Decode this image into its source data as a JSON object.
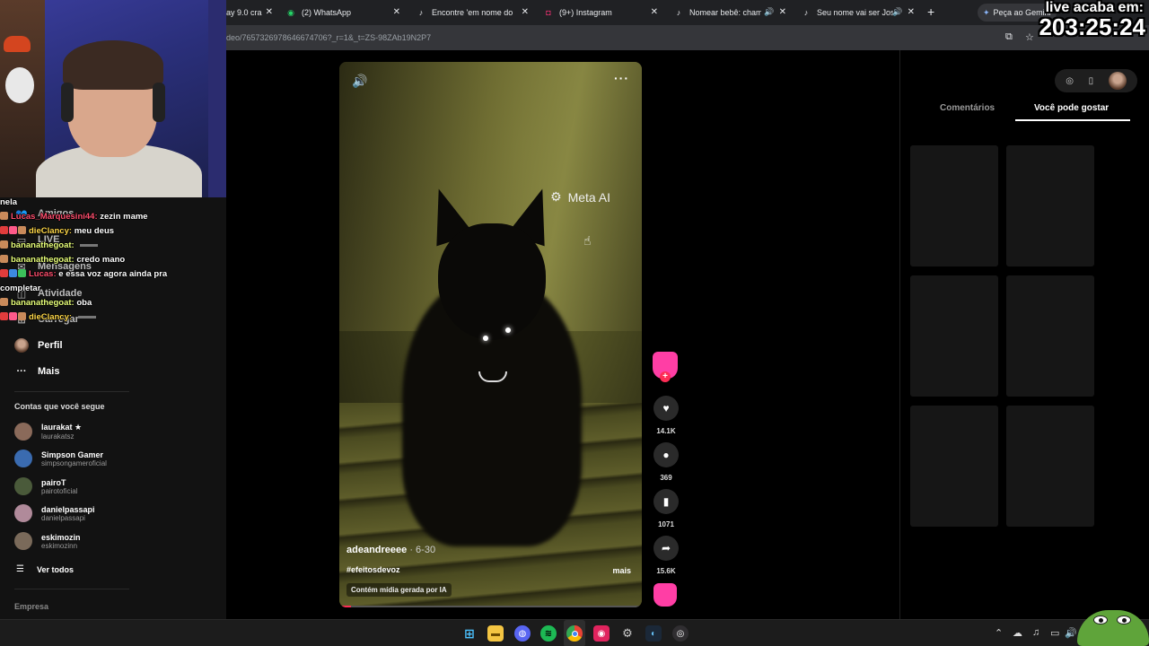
{
  "browser": {
    "tabs": [
      {
        "title": "ay 9.0 cra",
        "icon": "generic-icon"
      },
      {
        "title": "(2) WhatsApp",
        "icon": "whatsapp-icon"
      },
      {
        "title": "Encontre 'em nome do pa",
        "icon": "tiktok-icon"
      },
      {
        "title": "(9+) Instagram",
        "icon": "instagram-icon"
      },
      {
        "title": "Nomear bebê: chamar",
        "icon": "tiktok-icon"
      },
      {
        "title": "Seu nome vai ser José",
        "icon": "tiktok-icon"
      }
    ],
    "gemini_label": "Peça ao Gemini",
    "url": "deo/7657326978646674706?_r=1&_t=ZS-98ZAb19N2P7"
  },
  "stream": {
    "timer_label": "live acaba em:",
    "timer_value": "203:25:24",
    "chat": [
      {
        "user": "",
        "text": "nela",
        "color": "#ffffff",
        "badges": []
      },
      {
        "user": "Lucas_Marquesini44:",
        "text": "zezin mame",
        "color": "#ff4f6e",
        "badges": [
          "#c98a5a"
        ]
      },
      {
        "user": "dieClancy:",
        "text": "meu deus",
        "color": "#ffd84a",
        "badges": [
          "#e03c3c",
          "#ff5a8a",
          "#c98a5a"
        ]
      },
      {
        "user": "bananathegoat:",
        "text": "",
        "color": "#e8ff7a",
        "badges": [
          "#c98a5a"
        ]
      },
      {
        "user": "bananathegoat:",
        "text": "credo mano",
        "color": "#e8ff7a",
        "badges": [
          "#c98a5a"
        ]
      },
      {
        "user": "Lucas:",
        "text": "e essa voz agora ainda pra",
        "color": "#ff4f6e",
        "badges": [
          "#e03c3c",
          "#3c8ae0",
          "#3cc05a"
        ]
      },
      {
        "user": "",
        "text": "completar",
        "color": "#ffffff",
        "badges": []
      },
      {
        "user": "bananathegoat:",
        "text": "oba",
        "color": "#e8ff7a",
        "badges": [
          "#c98a5a"
        ]
      },
      {
        "user": "dieClancy:",
        "text": "",
        "color": "#ffd84a",
        "badges": [
          "#e03c3c",
          "#ff5a8a",
          "#c98a5a"
        ]
      }
    ]
  },
  "sidebar": {
    "nav": [
      {
        "label": "Amigos",
        "icon": "friends-icon"
      },
      {
        "label": "LIVE",
        "icon": "live-icon"
      },
      {
        "label": "Mensagens",
        "icon": "messages-icon"
      },
      {
        "label": "Atividade",
        "icon": "activity-icon"
      },
      {
        "label": "Carregar",
        "icon": "upload-icon"
      },
      {
        "label": "Perfil",
        "icon": "profile-icon"
      },
      {
        "label": "Mais",
        "icon": "more-icon"
      }
    ],
    "following_title": "Contas que você segue",
    "accounts": [
      {
        "name": "laurakat ★",
        "handle": "laurakatsz",
        "color": "#8a6a5a"
      },
      {
        "name": "Simpson Gamer",
        "handle": "simpsongameroficial",
        "color": "#3a6bb0"
      },
      {
        "name": "pairoT",
        "handle": "pairotoficial",
        "color": "#4a5a3a"
      },
      {
        "name": "danielpassapi",
        "handle": "danielpassapi",
        "color": "#b08a9a"
      },
      {
        "name": "eskimozin",
        "handle": "eskimozinn",
        "color": "#7a6a5a"
      }
    ],
    "see_all": "Ver todos",
    "company": "Empresa"
  },
  "video": {
    "meta_ai": "Meta AI",
    "author": "adeandreeee",
    "date": " · 6-30",
    "hashtag": "#efeitosdevoz",
    "more": "mais",
    "ai_label": "Contém mídia gerada por IA",
    "progress_fraction": 0.04
  },
  "actions": {
    "likes": "14.1K",
    "comments": "369",
    "saves": "1071",
    "shares": "15.6K"
  },
  "right_panel": {
    "tab_comments": "Comentários",
    "tab_suggested": "Você pode gostar"
  },
  "taskbar": {
    "apps": [
      "windows-start-icon",
      "file-explorer-icon",
      "discord-icon",
      "spotify-icon",
      "chrome-icon",
      "app-red-icon",
      "settings-icon",
      "steam-icon",
      "obs-icon"
    ]
  }
}
